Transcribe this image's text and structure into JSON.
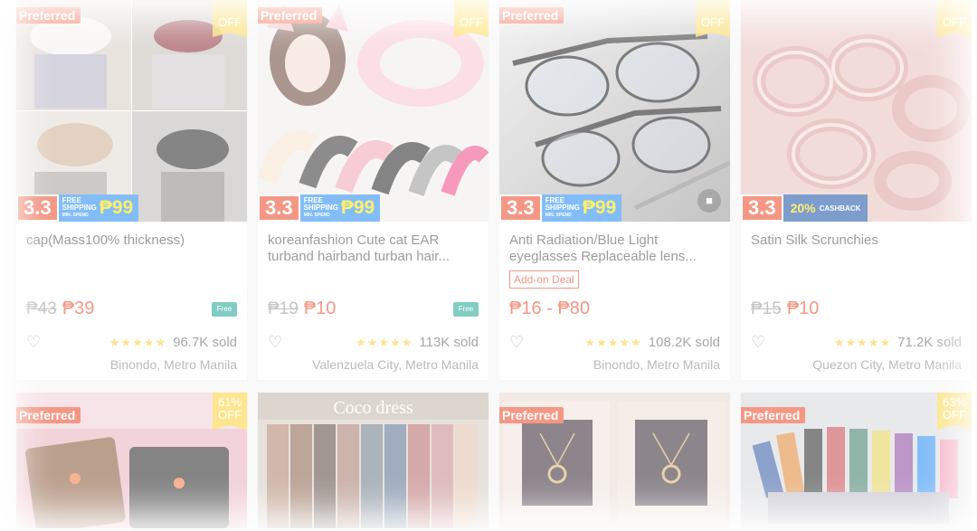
{
  "products": [
    {
      "badge": "Preferred",
      "discount": "OFF",
      "promo": {
        "event": "3.3",
        "line1": "FREE",
        "line2": "SHIPPING",
        "line3": "MIN. SPEND",
        "amount": "₱99"
      },
      "title": "cap(Mass100% thickness)",
      "original_price": "₱43",
      "price": "₱39",
      "free_shipping": "Free",
      "rating_stars": "★★★★★",
      "sold": "96.7K sold",
      "location": "Binondo, Metro Manila"
    },
    {
      "badge": "Preferred",
      "discount": "OFF",
      "promo": {
        "event": "3.3",
        "line1": "FREE",
        "line2": "SHIPPING",
        "line3": "MIN. SPEND",
        "amount": "₱99"
      },
      "title": "koreanfashion Cute cat EAR turband hairband turban hair...",
      "original_price": "₱19",
      "price": "₱10",
      "free_shipping": "Free",
      "rating_stars": "★★★★★",
      "sold": "113K sold",
      "location": "Valenzuela City, Metro Manila"
    },
    {
      "badge": "Preferred",
      "discount": "OFF",
      "promo": {
        "event": "3.3",
        "line1": "FREE",
        "line2": "SHIPPING",
        "line3": "MIN. SPEND",
        "amount": "₱99"
      },
      "title": "Anti Radiation/Blue Light eyeglasses Replaceable lens...",
      "addon": "Add-on Deal",
      "price": "₱16 - ₱80",
      "rating_stars": "★★★★★",
      "sold": "108.2K sold",
      "location": "Binondo, Metro Manila"
    },
    {
      "discount": "OFF",
      "promo": {
        "event": "3.3",
        "cashback": "20%",
        "cashback_label": "CASHBACK"
      },
      "title": "Satin Silk Scrunchies",
      "original_price": "₱15",
      "price": "₱10",
      "rating_stars": "★★★★★",
      "sold": "71.2K sold",
      "location": "Quezon City, Metro Manila"
    },
    {
      "badge": "Preferred",
      "discount_pct": "61%",
      "discount": "OFF"
    },
    {
      "overlay_text": "Coco dress"
    },
    {
      "badge": "Preferred"
    },
    {
      "badge": "Preferred",
      "discount_pct": "63%",
      "discount": "OFF"
    }
  ],
  "colors": {
    "accent": "#ee4d2d",
    "teal": "#26aa99",
    "star": "#ffce3d",
    "promo_blue": "#2a8df5"
  },
  "icons": {
    "wishlist": "heart-icon",
    "shipping": "truck-icon",
    "video": "video-camera-icon"
  }
}
